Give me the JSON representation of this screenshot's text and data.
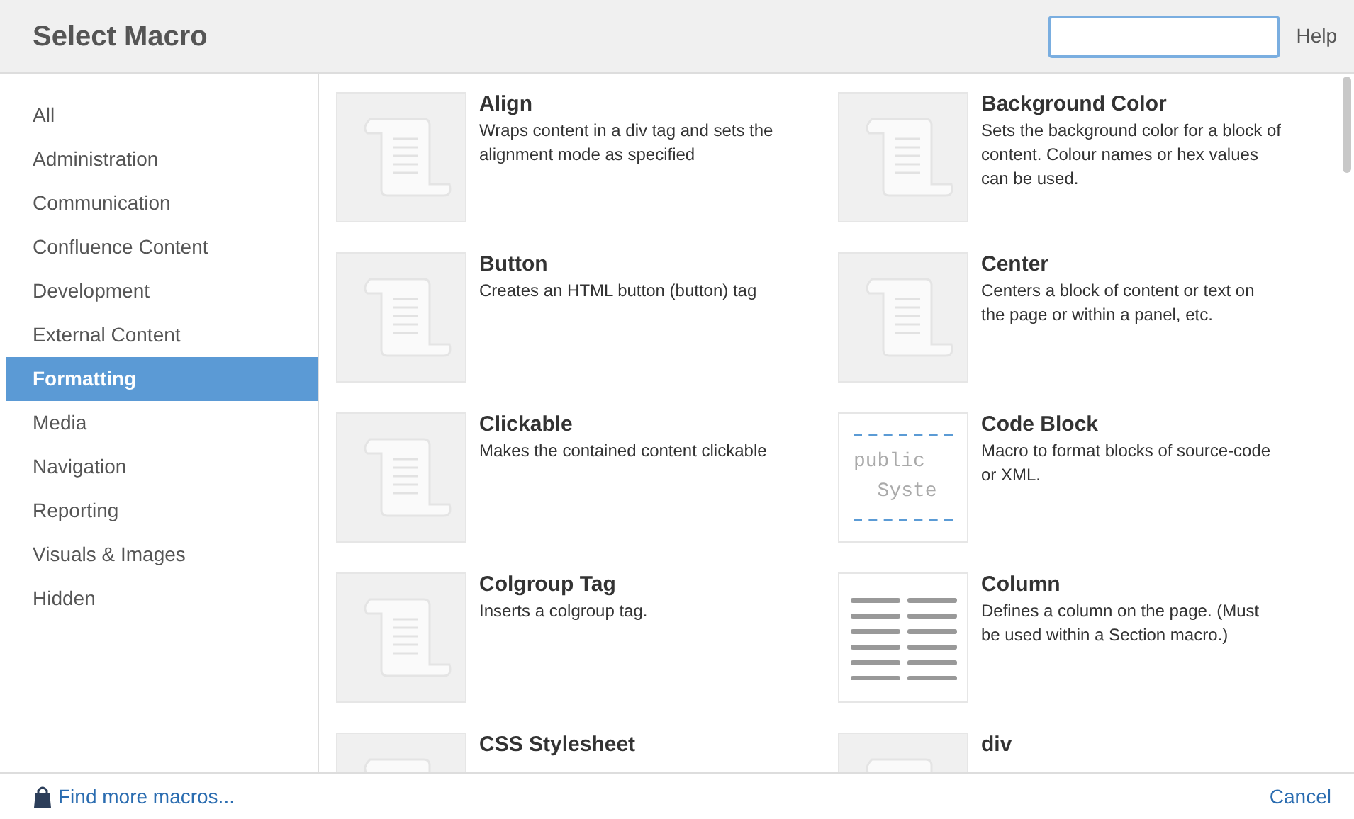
{
  "dialog": {
    "title": "Select Macro",
    "help": "Help"
  },
  "sidebar": {
    "items": [
      {
        "label": "All",
        "selected": false
      },
      {
        "label": "Administration",
        "selected": false
      },
      {
        "label": "Communication",
        "selected": false
      },
      {
        "label": "Confluence Content",
        "selected": false
      },
      {
        "label": "Development",
        "selected": false
      },
      {
        "label": "External Content",
        "selected": false
      },
      {
        "label": "Formatting",
        "selected": true
      },
      {
        "label": "Media",
        "selected": false
      },
      {
        "label": "Navigation",
        "selected": false
      },
      {
        "label": "Reporting",
        "selected": false
      },
      {
        "label": "Visuals & Images",
        "selected": false
      },
      {
        "label": "Hidden",
        "selected": false
      }
    ]
  },
  "macros": [
    {
      "kind": "scroll",
      "title": "Align",
      "description": "Wraps content in a div tag and sets the alignment mode as specified"
    },
    {
      "kind": "scroll",
      "title": "Background Color",
      "description": "Sets the background color for a block of content. Colour names or hex values can be used."
    },
    {
      "kind": "scroll",
      "title": "Button",
      "description": "Creates an HTML button (button) tag"
    },
    {
      "kind": "scroll",
      "title": "Center",
      "description": "Centers a block of content or text on the page or within a panel, etc."
    },
    {
      "kind": "scroll",
      "title": "Clickable",
      "description": "Makes the contained content clickable"
    },
    {
      "kind": "code",
      "title": "Code Block",
      "description": "Macro to format blocks of source-code or XML.",
      "code_lines": [
        "public",
        "  Syste"
      ]
    },
    {
      "kind": "scroll",
      "title": "Colgroup Tag",
      "description": "Inserts a colgroup tag."
    },
    {
      "kind": "columns",
      "title": "Column",
      "description": "Defines a column on the page. (Must be used within a Section macro.)"
    },
    {
      "kind": "scroll",
      "title": "CSS Stylesheet"
    },
    {
      "kind": "scroll",
      "title": "div"
    }
  ],
  "footer": {
    "link": "Find more macros...",
    "cancel": "Cancel"
  }
}
